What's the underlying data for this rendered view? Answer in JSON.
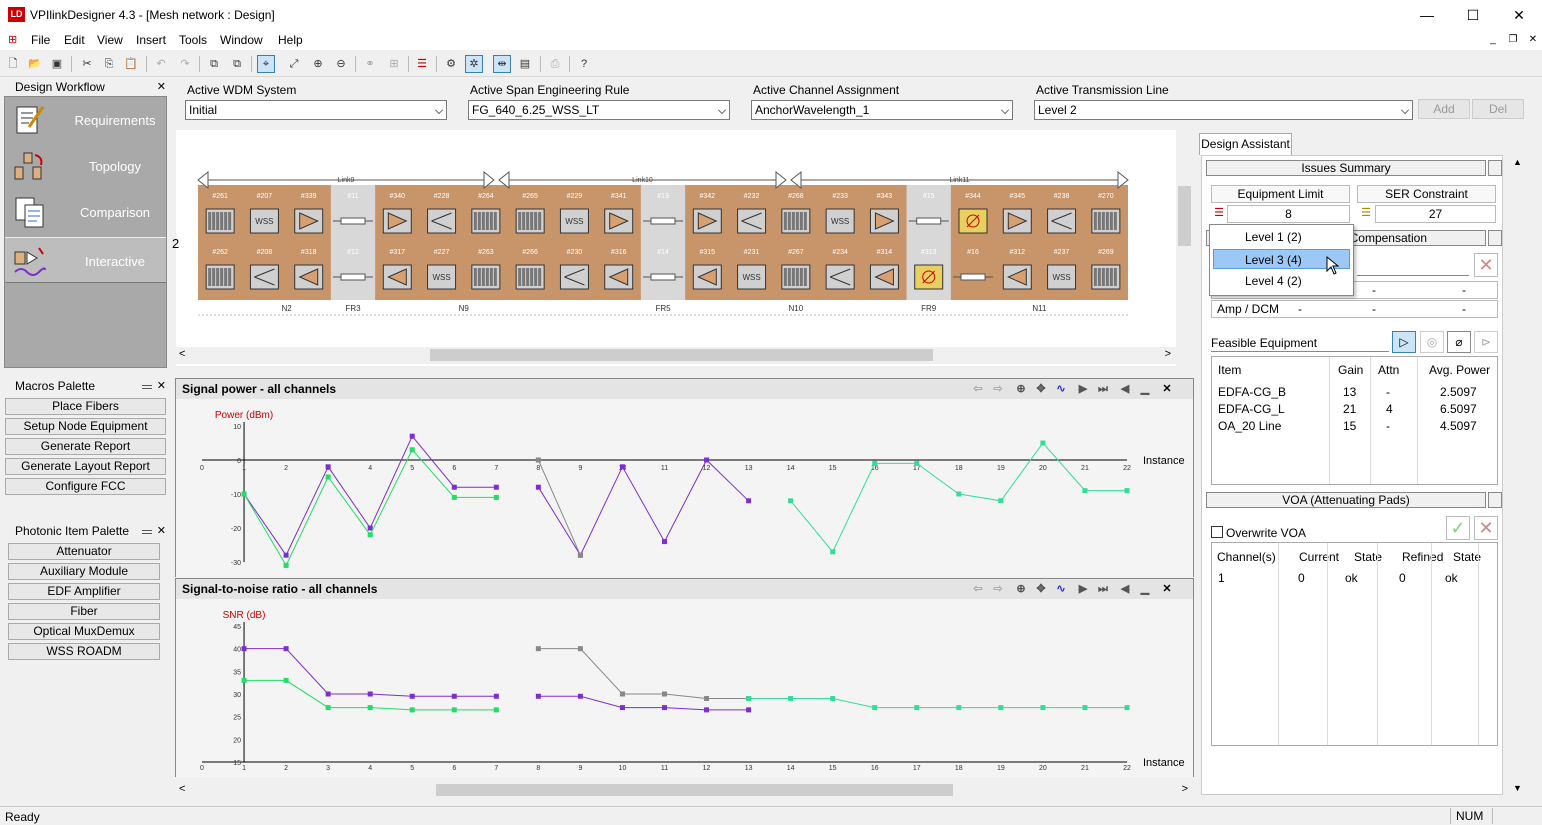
{
  "window": {
    "title": "VPIlinkDesigner 4.3 - [Mesh network : Design]",
    "logo": "LD",
    "minimize": "—",
    "maximize": "☐",
    "close": "✕"
  },
  "menu": [
    "File",
    "Edit",
    "View",
    "Insert",
    "Tools",
    "Window",
    "Help"
  ],
  "left": {
    "workflow_title": "Design Workflow",
    "workflow_items": [
      "Requirements",
      "Topology",
      "Comparison",
      "Interactive"
    ],
    "macros_title": "Macros Palette",
    "macros": [
      "Place Fibers",
      "Setup Node Equipment",
      "Generate Report",
      "Generate Layout Report",
      "Configure FCC"
    ],
    "photonic_title": "Photonic Item Palette",
    "photonic": [
      "Attenuator",
      "Auxiliary Module",
      "EDF Amplifier",
      "Fiber",
      "Optical MuxDemux",
      "WSS ROADM"
    ]
  },
  "selectors": {
    "wdm_label": "Active WDM System",
    "wdm_value": "Initial",
    "span_label": "Active Span Engineering Rule",
    "span_value": "FG_640_6.25_WSS_LT",
    "channel_label": "Active Channel Assignment",
    "channel_value": "AnchorWavelength_1",
    "line_label": "Active Transmission Line",
    "line_value": "Level 2",
    "add": "Add",
    "del": "Del"
  },
  "diagram": {
    "links": [
      "Link9",
      "Link10",
      "Link11"
    ],
    "top_ids": [
      "#261",
      "#207",
      "#339",
      "#11",
      "#340",
      "#228",
      "#264",
      "#265",
      "#229",
      "#341",
      "#13",
      "#342",
      "#232",
      "#268",
      "#233",
      "#343",
      "#15",
      "#344",
      "#345",
      "#238",
      "#270"
    ],
    "bottom_ids": [
      "#262",
      "#208",
      "#318",
      "#12",
      "#317",
      "#227",
      "#263",
      "#266",
      "#230",
      "#316",
      "#14",
      "#315",
      "#231",
      "#267",
      "#234",
      "#314",
      "#313",
      "#16",
      "#312",
      "#237",
      "#269"
    ],
    "nodes": [
      "N2",
      "FR3",
      "N9",
      "FR5",
      "N10",
      "FR9",
      "N11"
    ],
    "side_label": "2"
  },
  "power_chart": {
    "pane_title": "Signal power - all channels",
    "y_title": "Power (dBm)",
    "x_title": "Instance",
    "y_ticks": [
      "10",
      "0",
      "-10",
      "-20",
      "-30"
    ],
    "x_ticks": [
      "0",
      "1",
      "2",
      "3",
      "4",
      "5",
      "6",
      "7",
      "8",
      "9",
      "10",
      "11",
      "12",
      "13",
      "14",
      "15",
      "16",
      "17",
      "18",
      "19",
      "20",
      "21",
      "22"
    ]
  },
  "snr_chart": {
    "pane_title": "Signal-to-noise ratio - all channels",
    "y_title": "SNR (dB)",
    "x_title": "Instance",
    "y_ticks": [
      "45",
      "40",
      "35",
      "30",
      "25",
      "20",
      "15"
    ],
    "x_ticks": [
      "0",
      "1",
      "2",
      "3",
      "4",
      "5",
      "6",
      "7",
      "8",
      "9",
      "10",
      "11",
      "12",
      "13",
      "14",
      "15",
      "16",
      "17",
      "18",
      "19",
      "20",
      "21",
      "22"
    ]
  },
  "chart_data": [
    {
      "type": "line",
      "title": "Signal power - all channels",
      "ylabel": "Power (dBm)",
      "xlabel": "Instance",
      "xlim": [
        0,
        22
      ],
      "ylim": [
        -30,
        10
      ],
      "series": [
        {
          "x": [
            1,
            2,
            3,
            4,
            5,
            6,
            7
          ],
          "y": [
            -10,
            -28,
            -2,
            -20,
            7,
            -8,
            -8
          ],
          "color": "#7b2fd0"
        },
        {
          "x": [
            1,
            2,
            3,
            4,
            5,
            6,
            7
          ],
          "y": [
            -10,
            -31,
            -5,
            -22,
            3,
            -11,
            -11
          ],
          "color": "#22dd66"
        },
        {
          "x": [
            8,
            9,
            10,
            11,
            12,
            13
          ],
          "y": [
            -8,
            -28,
            -2,
            -24,
            0,
            -12
          ],
          "color": "#7b2fd0"
        },
        {
          "x": [
            8,
            9
          ],
          "y": [
            0,
            -28
          ],
          "color": "#888888"
        },
        {
          "x": [
            14,
            15,
            16,
            17,
            18,
            19,
            20,
            21,
            22
          ],
          "y": [
            -12,
            -27,
            -1,
            -1,
            -10,
            -12,
            5,
            -9,
            -9
          ],
          "color": "#33dd99"
        }
      ]
    },
    {
      "type": "line",
      "title": "Signal-to-noise ratio - all channels",
      "ylabel": "SNR (dB)",
      "xlabel": "Instance",
      "xlim": [
        0,
        22
      ],
      "ylim": [
        15,
        45
      ],
      "series": [
        {
          "x": [
            1,
            2,
            3,
            4,
            5,
            6,
            7
          ],
          "y": [
            40,
            40,
            30,
            30,
            29.5,
            29.5,
            29.5
          ],
          "color": "#7b2fd0"
        },
        {
          "x": [
            1,
            2,
            3,
            4,
            5,
            6,
            7
          ],
          "y": [
            33,
            33,
            27,
            27,
            26.5,
            26.5,
            26.5
          ],
          "color": "#22dd66"
        },
        {
          "x": [
            8,
            9,
            10,
            11,
            12,
            13
          ],
          "y": [
            40,
            40,
            30,
            30,
            29,
            29
          ],
          "color": "#888888"
        },
        {
          "x": [
            8,
            9,
            10,
            11,
            12,
            13
          ],
          "y": [
            29.5,
            29.5,
            27,
            27,
            26.5,
            26.5
          ],
          "color": "#7b2fd0"
        },
        {
          "x": [
            13,
            14,
            15,
            16,
            17,
            18,
            19,
            20,
            21,
            22
          ],
          "y": [
            29,
            29,
            29,
            27,
            27,
            27,
            27,
            27,
            27,
            27
          ],
          "color": "#33dd99"
        }
      ]
    }
  ],
  "assistant": {
    "tab": "Design Assistant",
    "issues_title": "Issues Summary",
    "equip_label": "Equipment Limit Violations",
    "equip_value": "8",
    "ser_label": "SER Constraint Violations",
    "ser_value": "27",
    "comp_partial": "n Compensation",
    "dropdown": [
      "Level 1 (2)",
      "Level 3 (4)",
      "Level 4 (2)"
    ],
    "amp_dcm": "Amp / DCM",
    "dash": "-",
    "feasible_title": "Feasible Equipment",
    "feasible_headers": [
      "Item",
      "Gain",
      "Attn",
      "Avg. Power"
    ],
    "feasible_rows": [
      [
        "EDFA-CG_B",
        "13",
        "-",
        "2.5097"
      ],
      [
        "EDFA-CG_L",
        "21",
        "4",
        "6.5097"
      ],
      [
        "OA_20 Line",
        "15",
        "-",
        "4.5097"
      ]
    ],
    "voa_title": "VOA (Attenuating Pads)",
    "overwrite": "Overwrite VOA",
    "voa_headers": [
      "Channel(s)",
      "Current",
      "State",
      "Refined",
      "State"
    ],
    "voa_row": [
      "1",
      "0",
      "ok",
      "0",
      "ok"
    ]
  },
  "status": {
    "ready": "Ready",
    "num": "NUM"
  }
}
